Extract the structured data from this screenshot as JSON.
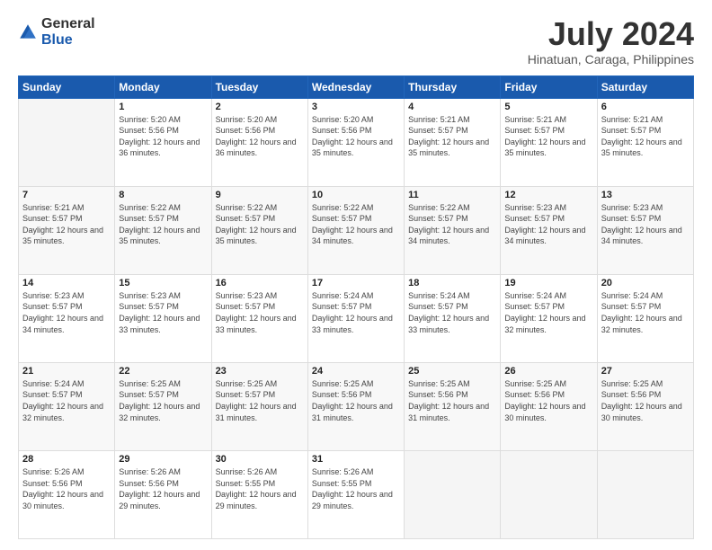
{
  "header": {
    "logo_general": "General",
    "logo_blue": "Blue",
    "main_title": "July 2024",
    "subtitle": "Hinatuan, Caraga, Philippines"
  },
  "days_of_week": [
    "Sunday",
    "Monday",
    "Tuesday",
    "Wednesday",
    "Thursday",
    "Friday",
    "Saturday"
  ],
  "weeks": [
    [
      {
        "day": "",
        "empty": true
      },
      {
        "day": "1",
        "sunrise": "5:20 AM",
        "sunset": "5:56 PM",
        "daylight": "12 hours and 36 minutes."
      },
      {
        "day": "2",
        "sunrise": "5:20 AM",
        "sunset": "5:56 PM",
        "daylight": "12 hours and 36 minutes."
      },
      {
        "day": "3",
        "sunrise": "5:20 AM",
        "sunset": "5:56 PM",
        "daylight": "12 hours and 35 minutes."
      },
      {
        "day": "4",
        "sunrise": "5:21 AM",
        "sunset": "5:57 PM",
        "daylight": "12 hours and 35 minutes."
      },
      {
        "day": "5",
        "sunrise": "5:21 AM",
        "sunset": "5:57 PM",
        "daylight": "12 hours and 35 minutes."
      },
      {
        "day": "6",
        "sunrise": "5:21 AM",
        "sunset": "5:57 PM",
        "daylight": "12 hours and 35 minutes."
      }
    ],
    [
      {
        "day": "7",
        "sunrise": "5:21 AM",
        "sunset": "5:57 PM",
        "daylight": "12 hours and 35 minutes."
      },
      {
        "day": "8",
        "sunrise": "5:22 AM",
        "sunset": "5:57 PM",
        "daylight": "12 hours and 35 minutes."
      },
      {
        "day": "9",
        "sunrise": "5:22 AM",
        "sunset": "5:57 PM",
        "daylight": "12 hours and 35 minutes."
      },
      {
        "day": "10",
        "sunrise": "5:22 AM",
        "sunset": "5:57 PM",
        "daylight": "12 hours and 34 minutes."
      },
      {
        "day": "11",
        "sunrise": "5:22 AM",
        "sunset": "5:57 PM",
        "daylight": "12 hours and 34 minutes."
      },
      {
        "day": "12",
        "sunrise": "5:23 AM",
        "sunset": "5:57 PM",
        "daylight": "12 hours and 34 minutes."
      },
      {
        "day": "13",
        "sunrise": "5:23 AM",
        "sunset": "5:57 PM",
        "daylight": "12 hours and 34 minutes."
      }
    ],
    [
      {
        "day": "14",
        "sunrise": "5:23 AM",
        "sunset": "5:57 PM",
        "daylight": "12 hours and 34 minutes."
      },
      {
        "day": "15",
        "sunrise": "5:23 AM",
        "sunset": "5:57 PM",
        "daylight": "12 hours and 33 minutes."
      },
      {
        "day": "16",
        "sunrise": "5:23 AM",
        "sunset": "5:57 PM",
        "daylight": "12 hours and 33 minutes."
      },
      {
        "day": "17",
        "sunrise": "5:24 AM",
        "sunset": "5:57 PM",
        "daylight": "12 hours and 33 minutes."
      },
      {
        "day": "18",
        "sunrise": "5:24 AM",
        "sunset": "5:57 PM",
        "daylight": "12 hours and 33 minutes."
      },
      {
        "day": "19",
        "sunrise": "5:24 AM",
        "sunset": "5:57 PM",
        "daylight": "12 hours and 32 minutes."
      },
      {
        "day": "20",
        "sunrise": "5:24 AM",
        "sunset": "5:57 PM",
        "daylight": "12 hours and 32 minutes."
      }
    ],
    [
      {
        "day": "21",
        "sunrise": "5:24 AM",
        "sunset": "5:57 PM",
        "daylight": "12 hours and 32 minutes."
      },
      {
        "day": "22",
        "sunrise": "5:25 AM",
        "sunset": "5:57 PM",
        "daylight": "12 hours and 32 minutes."
      },
      {
        "day": "23",
        "sunrise": "5:25 AM",
        "sunset": "5:57 PM",
        "daylight": "12 hours and 31 minutes."
      },
      {
        "day": "24",
        "sunrise": "5:25 AM",
        "sunset": "5:56 PM",
        "daylight": "12 hours and 31 minutes."
      },
      {
        "day": "25",
        "sunrise": "5:25 AM",
        "sunset": "5:56 PM",
        "daylight": "12 hours and 31 minutes."
      },
      {
        "day": "26",
        "sunrise": "5:25 AM",
        "sunset": "5:56 PM",
        "daylight": "12 hours and 30 minutes."
      },
      {
        "day": "27",
        "sunrise": "5:25 AM",
        "sunset": "5:56 PM",
        "daylight": "12 hours and 30 minutes."
      }
    ],
    [
      {
        "day": "28",
        "sunrise": "5:26 AM",
        "sunset": "5:56 PM",
        "daylight": "12 hours and 30 minutes."
      },
      {
        "day": "29",
        "sunrise": "5:26 AM",
        "sunset": "5:56 PM",
        "daylight": "12 hours and 29 minutes."
      },
      {
        "day": "30",
        "sunrise": "5:26 AM",
        "sunset": "5:55 PM",
        "daylight": "12 hours and 29 minutes."
      },
      {
        "day": "31",
        "sunrise": "5:26 AM",
        "sunset": "5:55 PM",
        "daylight": "12 hours and 29 minutes."
      },
      {
        "day": "",
        "empty": true
      },
      {
        "day": "",
        "empty": true
      },
      {
        "day": "",
        "empty": true
      }
    ]
  ]
}
